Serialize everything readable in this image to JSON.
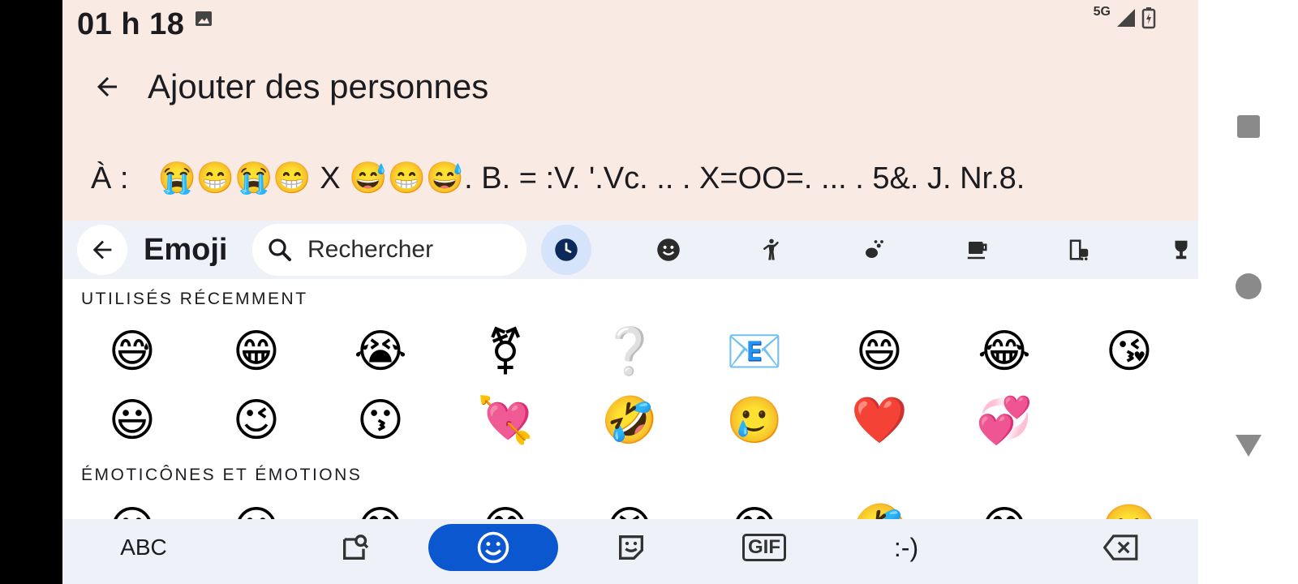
{
  "status_bar": {
    "time": "01 h 18",
    "network": "5G"
  },
  "app_bar": {
    "title": "Ajouter des personnes"
  },
  "recipients": {
    "label": "À :",
    "text": "😭😁😭😁 X 😅😁😅. B. = :V. '.Vc. .. . X=OO=. ... . 5&. J. Nr.8."
  },
  "keyboard": {
    "header_label": "Emoji",
    "search_placeholder": "Rechercher",
    "categories": [
      "recent-icon",
      "smiley-icon",
      "person-icon",
      "animal-icon",
      "food-icon",
      "travel-icon",
      "activity-icon"
    ],
    "recent_title": "UTILISÉS RÉCEMMENT",
    "recent_emojis": [
      "😅",
      "😁",
      "😭",
      "⚧",
      "❔",
      "📧",
      "😄",
      "😂",
      "😘",
      "😃",
      "😉",
      "😗",
      "💘",
      "🤣",
      "🥲",
      "❤️",
      "💞"
    ],
    "emotions_title": "ÉMOTICÔNES ET ÉMOTIONS",
    "emotion_emojis": [
      "😀",
      "😃",
      "😄",
      "😁",
      "😆",
      "😅",
      "🤣",
      "😂",
      "🙂"
    ],
    "bottom": {
      "abc": "ABC",
      "gif": "GIF",
      "emoticon": ":-)"
    }
  },
  "colors": {
    "accent": "#0b57d0",
    "header_bg": "#f9ebe3",
    "kb_bg": "#eef1f8"
  }
}
